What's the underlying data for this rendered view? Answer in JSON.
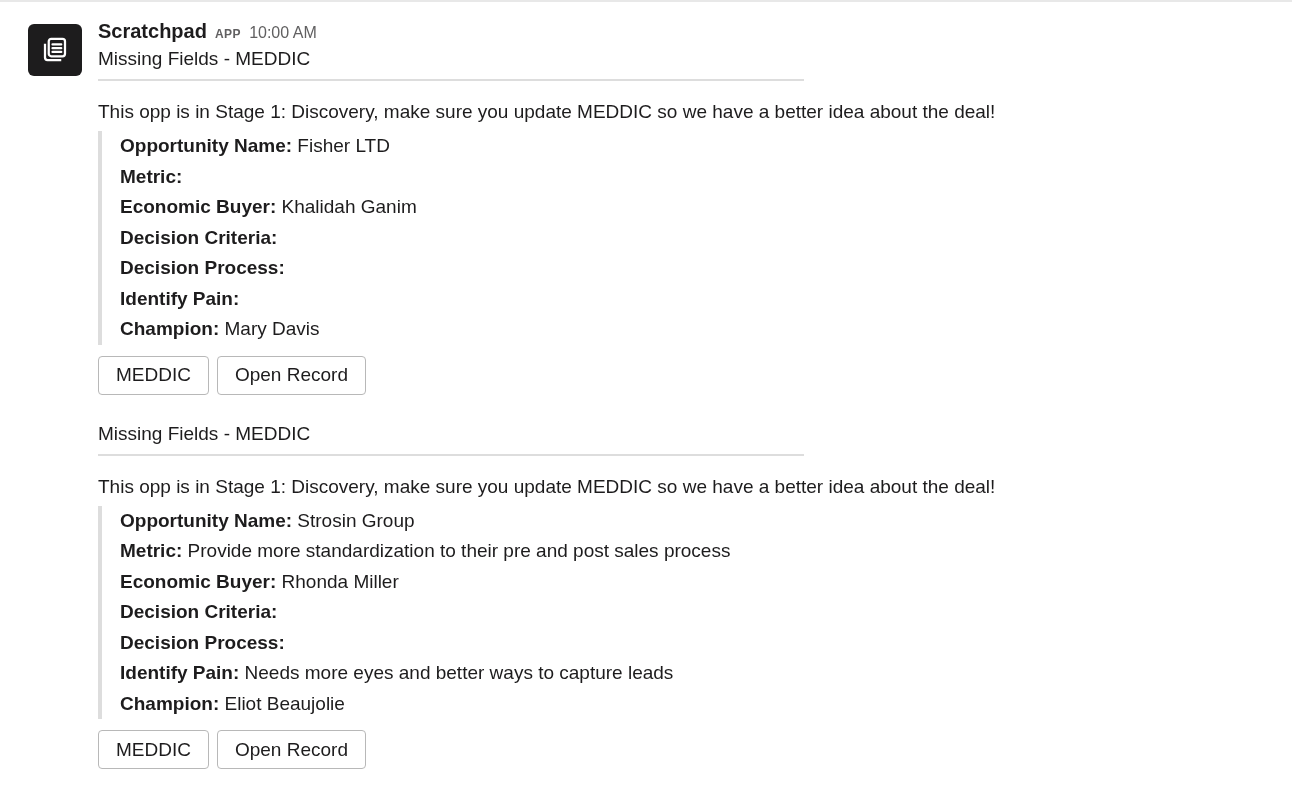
{
  "message": {
    "sender": "Scratchpad",
    "badge": "APP",
    "time": "10:00 AM"
  },
  "attachments": [
    {
      "title": "Missing Fields - MEDDIC",
      "text": "This opp is in Stage 1: Discovery, make sure you update MEDDIC so we have a better idea about the deal!",
      "fields": [
        {
          "label": "Opportunity Name:",
          "value": "Fisher LTD"
        },
        {
          "label": "Metric:"
        },
        {
          "label": "Economic Buyer:",
          "value": "Khalidah Ganim"
        },
        {
          "label": "Decision Criteria:"
        },
        {
          "label": "Decision Process:"
        },
        {
          "label": "Identify Pain:"
        },
        {
          "label": "Champion:",
          "value": "Mary Davis"
        }
      ],
      "buttons": [
        "MEDDIC",
        "Open Record"
      ]
    },
    {
      "title": "Missing Fields - MEDDIC",
      "text": "This opp is in Stage 1: Discovery, make sure you update MEDDIC so we have a better idea about the deal!",
      "fields": [
        {
          "label": "Opportunity Name:",
          "value": "Strosin Group"
        },
        {
          "label": "Metric:",
          "value": "Provide more standardization to their pre and post sales process"
        },
        {
          "label": "Economic Buyer:",
          "value": "Rhonda Miller"
        },
        {
          "label": "Decision Criteria:"
        },
        {
          "label": "Decision Process:"
        },
        {
          "label": "Identify Pain:",
          "value": "Needs more eyes and better ways to capture leads"
        },
        {
          "label": "Champion:",
          "value": "Eliot Beaujolie"
        }
      ],
      "buttons": [
        "MEDDIC",
        "Open Record"
      ]
    }
  ]
}
